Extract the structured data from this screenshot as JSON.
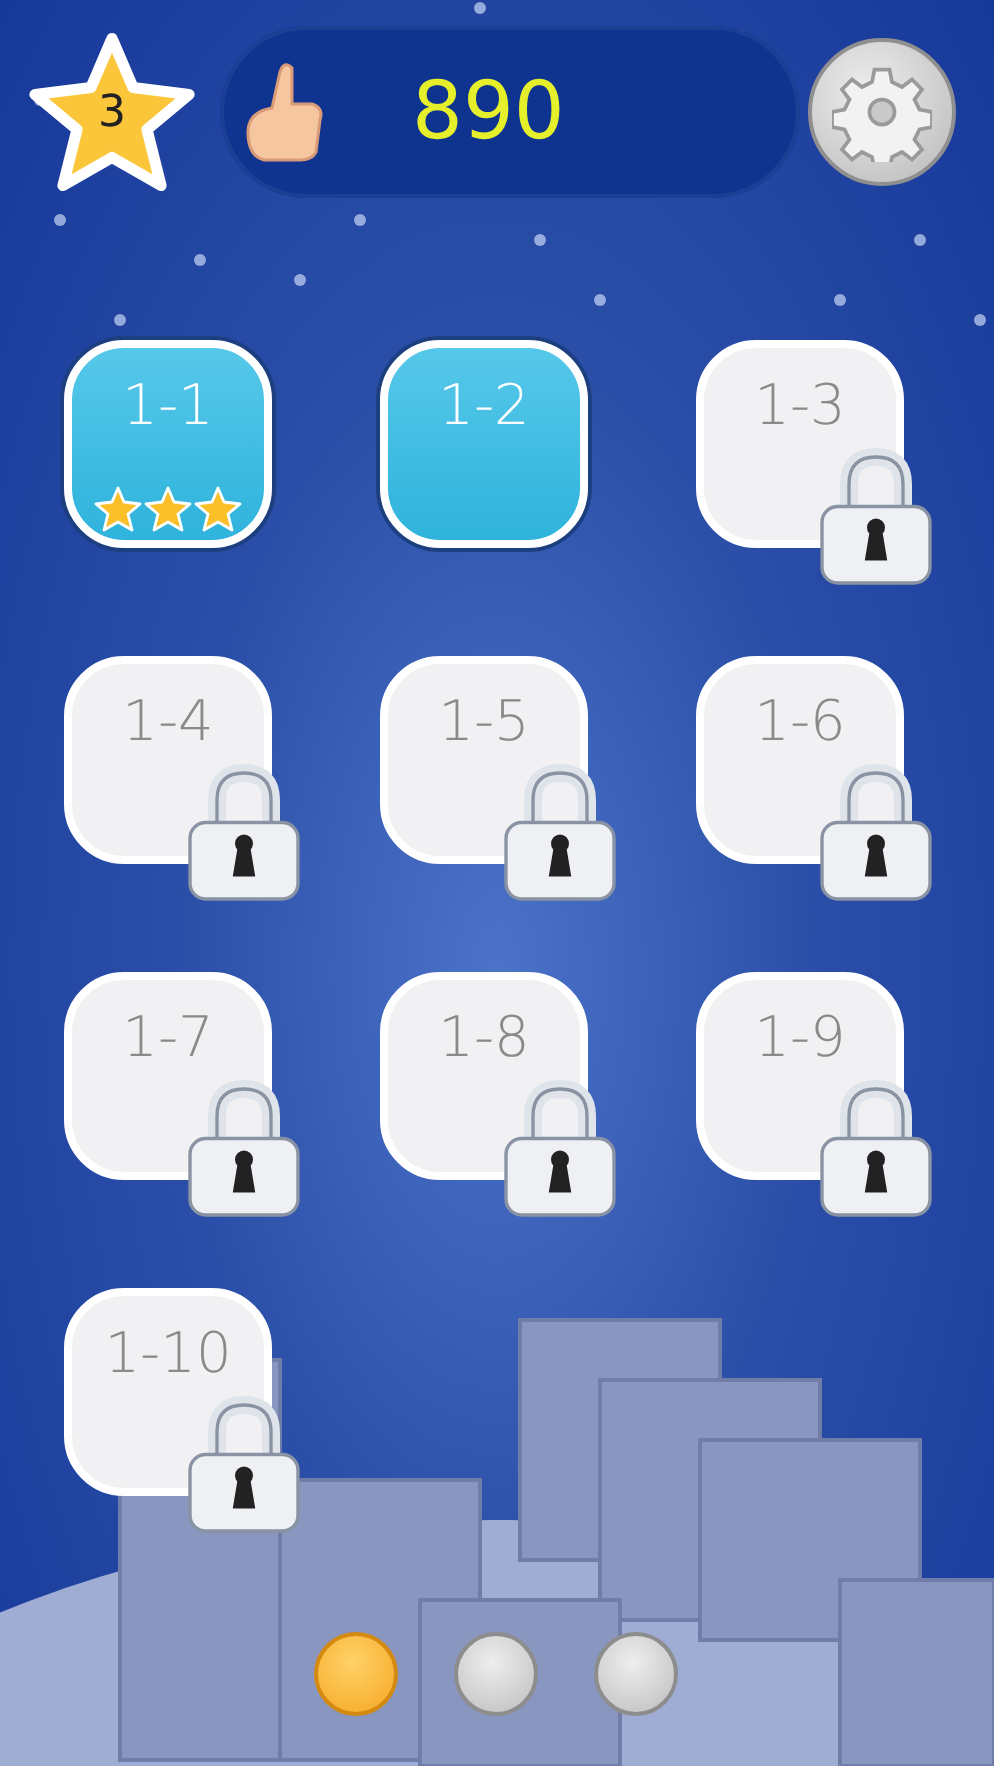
{
  "header": {
    "star_count": "3",
    "score": "890"
  },
  "levels": [
    {
      "label": "1-1",
      "locked": false,
      "stars": 3
    },
    {
      "label": "1-2",
      "locked": false
    },
    {
      "label": "1-3",
      "locked": true
    },
    {
      "label": "1-4",
      "locked": true
    },
    {
      "label": "1-5",
      "locked": true
    },
    {
      "label": "1-6",
      "locked": true
    },
    {
      "label": "1-7",
      "locked": true
    },
    {
      "label": "1-8",
      "locked": true
    },
    {
      "label": "1-9",
      "locked": true
    },
    {
      "label": "1-10",
      "locked": true
    }
  ],
  "pages": [
    {
      "selected": true
    },
    {
      "selected": false
    },
    {
      "selected": false
    }
  ]
}
